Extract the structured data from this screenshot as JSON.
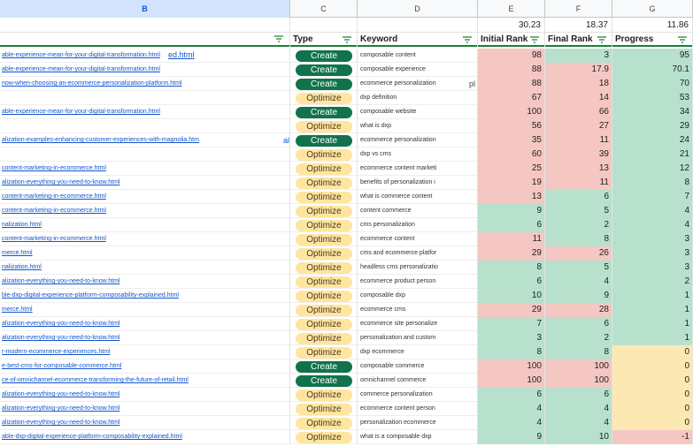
{
  "column_letters": [
    "B",
    "C",
    "D",
    "E",
    "F",
    "G"
  ],
  "aggregates": {
    "initial_rank": "30.23",
    "final_rank": "18.37",
    "progress": "11.86"
  },
  "headers": {
    "type": "Type",
    "keyword": "Keyword",
    "initial_rank": "Initial Rank",
    "final_rank": "Final Rank",
    "progress": "Progress"
  },
  "colors": {
    "create": "#11734b",
    "optimize": "#ffe5a0",
    "red": "#f4c7c3",
    "green": "#b7e1cd",
    "yellow": "#fce8b2",
    "header_border": "#188038"
  },
  "stray_text": {
    "row0_url": "ed.html",
    "row7_col_c": "al",
    "row2_keyword_tail": "pl"
  },
  "rows": [
    {
      "url": "able-experience-mean-for-your-digital-transformation.html",
      "type": "Create",
      "keyword": "composable content",
      "initial": "98",
      "final": "3",
      "progress": "95",
      "ic": "red",
      "fc": "green",
      "pc": "green"
    },
    {
      "url": "able-experience-mean-for-your-digital-transformation.html",
      "type": "Create",
      "keyword": "composable experience",
      "initial": "88",
      "final": "17.9",
      "progress": "70.1",
      "ic": "red",
      "fc": "red",
      "pc": "green"
    },
    {
      "url": "now-when-choosing-an-ecommerce-personalization-platform.html",
      "type": "Create",
      "keyword": "ecommerce personalization",
      "initial": "88",
      "final": "18",
      "progress": "70",
      "ic": "red",
      "fc": "red",
      "pc": "green"
    },
    {
      "url": "",
      "type": "Optimize",
      "keyword": "dxp definition",
      "initial": "67",
      "final": "14",
      "progress": "53",
      "ic": "red",
      "fc": "red",
      "pc": "green"
    },
    {
      "url": "able-experience-mean-for-your-digital-transformation.html",
      "type": "Create",
      "keyword": "composable website",
      "initial": "100",
      "final": "66",
      "progress": "34",
      "ic": "red",
      "fc": "red",
      "pc": "green"
    },
    {
      "url": "",
      "type": "Optimize",
      "keyword": "what is dxp",
      "initial": "56",
      "final": "27",
      "progress": "29",
      "ic": "red",
      "fc": "red",
      "pc": "green"
    },
    {
      "url": "alization-examples-enhancing-customer-experiences-with-magnolia.htm",
      "type": "Create",
      "keyword": "ecommerce personalization",
      "initial": "35",
      "final": "11",
      "progress": "24",
      "ic": "red",
      "fc": "red",
      "pc": "green"
    },
    {
      "url": "",
      "type": "Optimize",
      "keyword": "dxp vs cms",
      "initial": "60",
      "final": "39",
      "progress": "21",
      "ic": "red",
      "fc": "red",
      "pc": "green"
    },
    {
      "url": "content-marketing-in-ecommerce.html",
      "type": "Optimize",
      "keyword": "ecommerce content marketi",
      "initial": "25",
      "final": "13",
      "progress": "12",
      "ic": "red",
      "fc": "red",
      "pc": "green"
    },
    {
      "url": "alization-everything-you-need-to-know.html",
      "type": "Optimize",
      "keyword": "benefits of personalization i",
      "initial": "19",
      "final": "11",
      "progress": "8",
      "ic": "red",
      "fc": "red",
      "pc": "green"
    },
    {
      "url": "content-marketing-in-ecommerce.html",
      "type": "Optimize",
      "keyword": "what is commerce content",
      "initial": "13",
      "final": "6",
      "progress": "7",
      "ic": "red",
      "fc": "green",
      "pc": "green"
    },
    {
      "url": "content-marketing-in-ecommerce.html",
      "type": "Optimize",
      "keyword": "content commerce",
      "initial": "9",
      "final": "5",
      "progress": "4",
      "ic": "green",
      "fc": "green",
      "pc": "green"
    },
    {
      "url": "nalization.html",
      "type": "Optimize",
      "keyword": "cms personalization",
      "initial": "6",
      "final": "2",
      "progress": "4",
      "ic": "green",
      "fc": "green",
      "pc": "green"
    },
    {
      "url": "content-marketing-in-ecommerce.html",
      "type": "Optimize",
      "keyword": "ecommerce content",
      "initial": "11",
      "final": "8",
      "progress": "3",
      "ic": "red",
      "fc": "green",
      "pc": "green"
    },
    {
      "url": "merce.html",
      "type": "Optimize",
      "keyword": "cms and ecommerce platfor",
      "initial": "29",
      "final": "26",
      "progress": "3",
      "ic": "red",
      "fc": "red",
      "pc": "green"
    },
    {
      "url": "nalization.html",
      "type": "Optimize",
      "keyword": "headless cms personalizatio",
      "initial": "8",
      "final": "5",
      "progress": "3",
      "ic": "green",
      "fc": "green",
      "pc": "green"
    },
    {
      "url": "alization-everything-you-need-to-know.html",
      "type": "Optimize",
      "keyword": "ecommerce product person",
      "initial": "6",
      "final": "4",
      "progress": "2",
      "ic": "green",
      "fc": "green",
      "pc": "green"
    },
    {
      "url": "ble-dxp-digital-experience-platform-composability-explained.html",
      "type": "Optimize",
      "keyword": "composable dxp",
      "initial": "10",
      "final": "9",
      "progress": "1",
      "ic": "green",
      "fc": "green",
      "pc": "green"
    },
    {
      "url": "merce.html",
      "type": "Optimize",
      "keyword": "ecommerce cms",
      "initial": "29",
      "final": "28",
      "progress": "1",
      "ic": "red",
      "fc": "red",
      "pc": "green"
    },
    {
      "url": "alization-everything-you-need-to-know.html",
      "type": "Optimize",
      "keyword": "ecommerce site personalize",
      "initial": "7",
      "final": "6",
      "progress": "1",
      "ic": "green",
      "fc": "green",
      "pc": "green"
    },
    {
      "url": "alization-everything-you-need-to-know.html",
      "type": "Optimize",
      "keyword": "personalization and custom",
      "initial": "3",
      "final": "2",
      "progress": "1",
      "ic": "green",
      "fc": "green",
      "pc": "green"
    },
    {
      "url": "r-modern-ecommerce-experiences.html",
      "type": "Optimize",
      "keyword": "dxp ecommerce",
      "initial": "8",
      "final": "8",
      "progress": "0",
      "ic": "green",
      "fc": "green",
      "pc": "yellow"
    },
    {
      "url": "e-best-cms-for-composable-commerce.html",
      "type": "Create",
      "keyword": "composable commerce",
      "initial": "100",
      "final": "100",
      "progress": "0",
      "ic": "red",
      "fc": "red",
      "pc": "yellow"
    },
    {
      "url": "ce-of-omnichannel-ecommerce-transforming-the-future-of-retail.html",
      "type": "Create",
      "keyword": "omnichannel commerce",
      "initial": "100",
      "final": "100",
      "progress": "0",
      "ic": "red",
      "fc": "red",
      "pc": "yellow"
    },
    {
      "url": "alization-everything-you-need-to-know.html",
      "type": "Optimize",
      "keyword": "commerce personalization",
      "initial": "6",
      "final": "6",
      "progress": "0",
      "ic": "green",
      "fc": "green",
      "pc": "yellow"
    },
    {
      "url": "alization-everything-you-need-to-know.html",
      "type": "Optimize",
      "keyword": "ecommerce content person",
      "initial": "4",
      "final": "4",
      "progress": "0",
      "ic": "green",
      "fc": "green",
      "pc": "yellow"
    },
    {
      "url": "alization-everything-you-need-to-know.html",
      "type": "Optimize",
      "keyword": "personalization ecommerce",
      "initial": "4",
      "final": "4",
      "progress": "0",
      "ic": "green",
      "fc": "green",
      "pc": "yellow"
    },
    {
      "url": "able-dxp-digital-experience-platform-composability-explained.html",
      "type": "Optimize",
      "keyword": "what is a composable dxp",
      "initial": "9",
      "final": "10",
      "progress": "-1",
      "ic": "green",
      "fc": "green",
      "pc": "red"
    }
  ]
}
